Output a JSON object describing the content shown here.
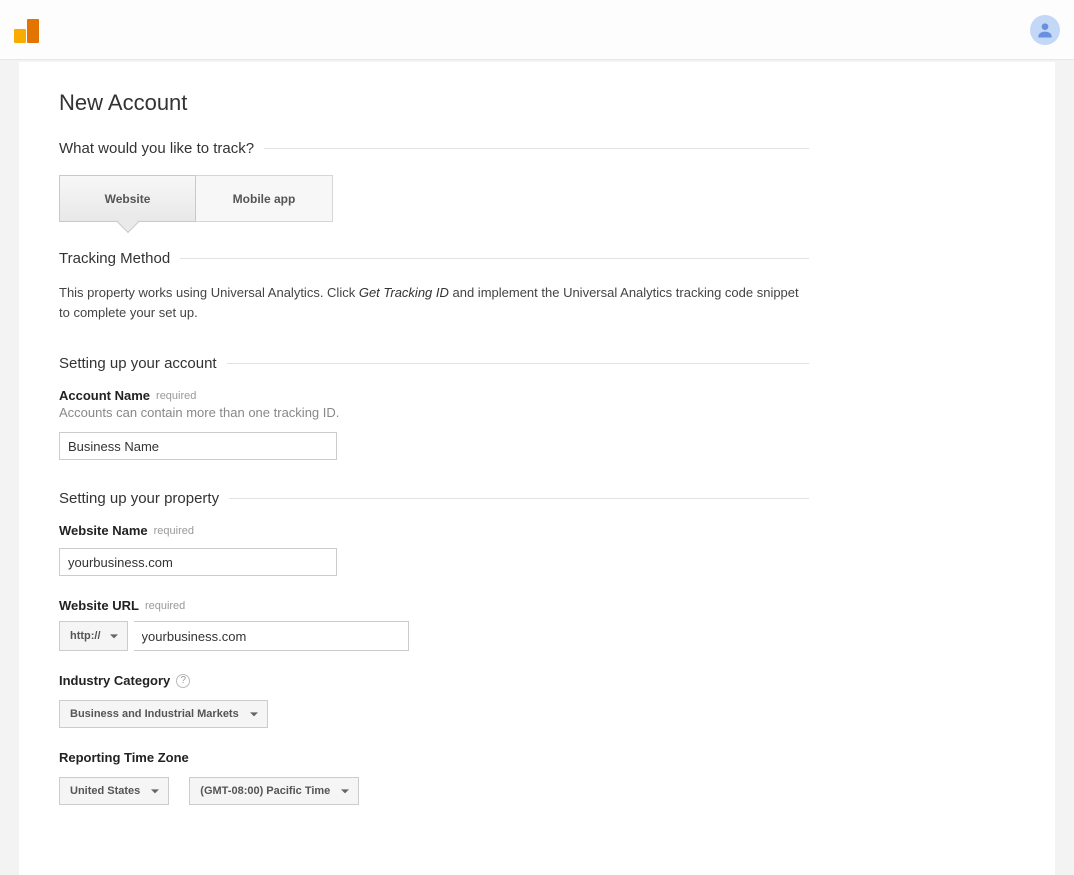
{
  "header": {
    "logo_name": "analytics-logo",
    "avatar_name": "user-avatar"
  },
  "page_title": "New Account",
  "sections": {
    "track_question": "What would you like to track?",
    "tabs": {
      "website": "Website",
      "mobile": "Mobile app"
    },
    "tracking_method": {
      "heading": "Tracking Method",
      "desc_part1": "This property works using Universal Analytics. Click ",
      "desc_em": "Get Tracking ID",
      "desc_part2": " and implement the Universal Analytics tracking code snippet to complete your set up."
    },
    "account_setup": {
      "heading": "Setting up your account",
      "account_name_label": "Account Name",
      "required_text": "required",
      "account_name_hint": "Accounts can contain more than one tracking ID.",
      "account_name_value": "Business Name"
    },
    "property_setup": {
      "heading": "Setting up your property",
      "website_name_label": "Website Name",
      "website_name_value": "yourbusiness.com",
      "website_url_label": "Website URL",
      "protocol_value": "http://",
      "website_url_value": "yourbusiness.com",
      "industry_label": "Industry Category",
      "industry_value": "Business and Industrial Markets",
      "timezone_label": "Reporting Time Zone",
      "timezone_country": "United States",
      "timezone_value": "(GMT-08:00) Pacific Time"
    }
  }
}
